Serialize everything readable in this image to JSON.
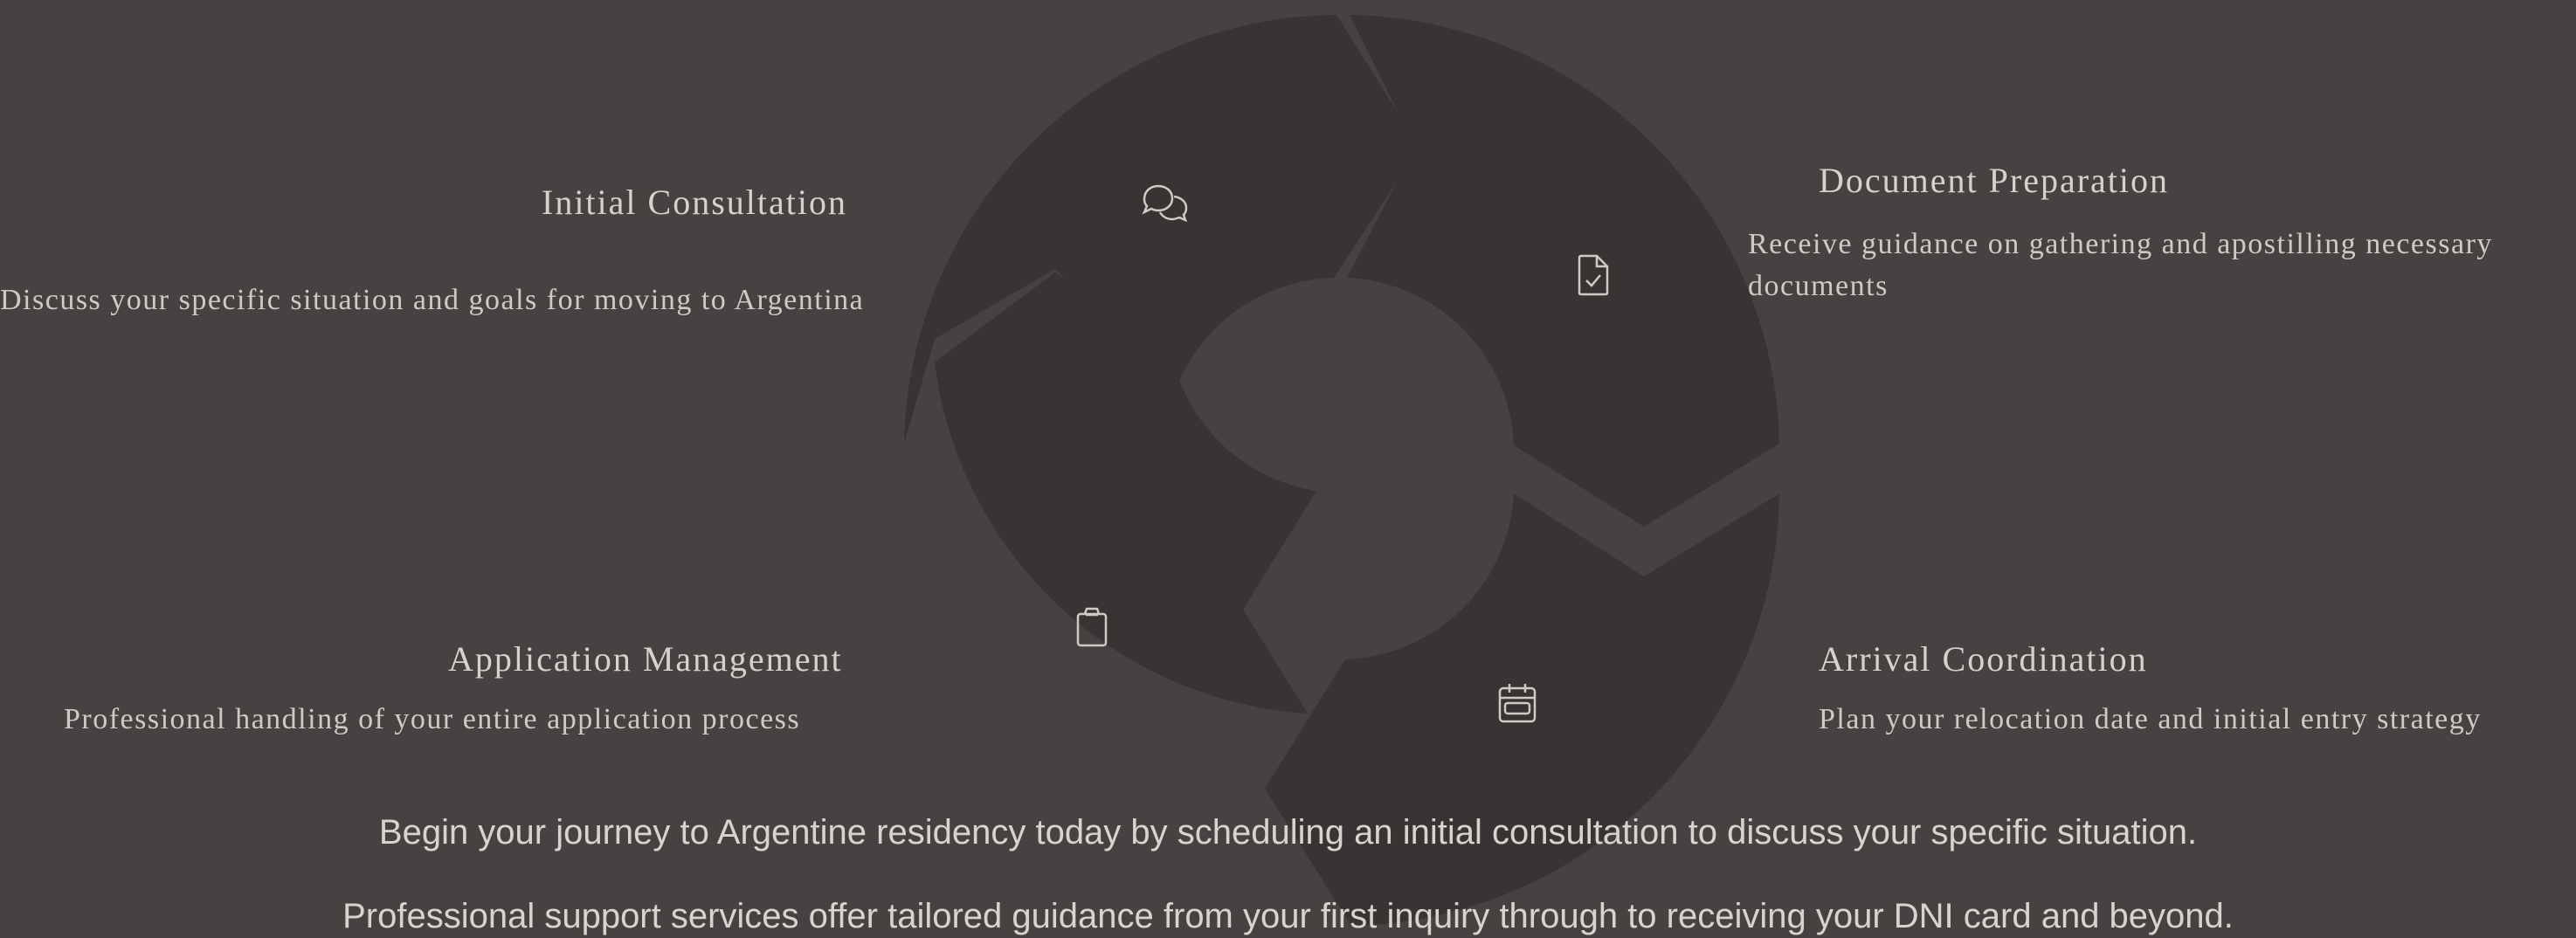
{
  "process": {
    "steps": [
      {
        "title": "Initial Consultation",
        "description": "Discuss your specific situation and goals for moving to Argentina",
        "icon": "chat-bubbles-icon"
      },
      {
        "title": "Document Preparation",
        "description": "Receive guidance on gathering and apostilling necessary documents",
        "icon": "document-check-icon"
      },
      {
        "title": "Arrival Coordination",
        "description": "Plan your relocation date and initial entry strategy",
        "icon": "calendar-icon"
      },
      {
        "title": "Application Management",
        "description": "Professional handling of your entire application process",
        "icon": "clipboard-icon"
      }
    ]
  },
  "cta": {
    "line1": "Begin your journey to Argentine residency today by scheduling an initial consultation to discuss your specific situation.",
    "line2": "Professional support services offer tailored guidance from your first inquiry through to receiving your DNI card and beyond."
  },
  "colors": {
    "background": "#464241",
    "segment": "#383433",
    "text": "#cfcac6"
  }
}
